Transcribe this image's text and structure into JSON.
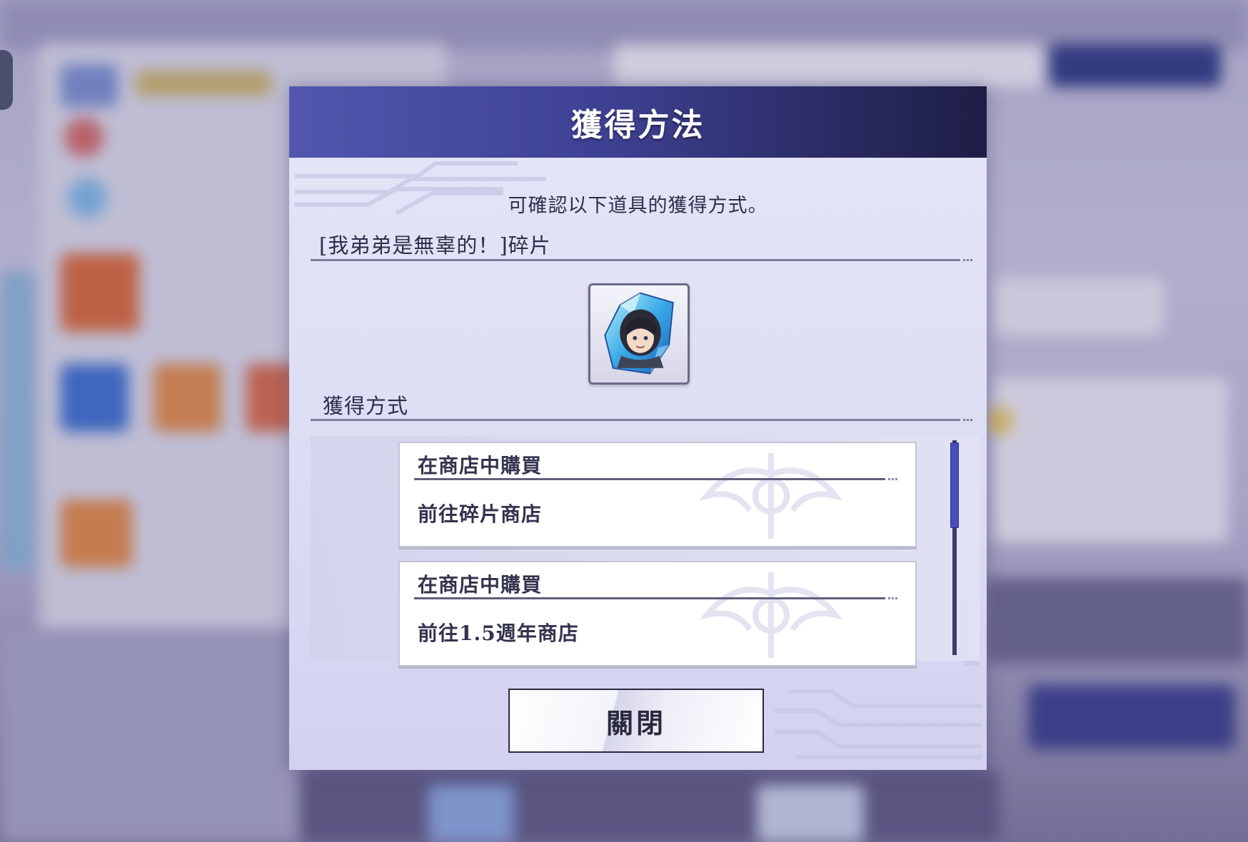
{
  "dialog": {
    "title": "獲得方法",
    "subtitle": "可確認以下道具的獲得方式。",
    "item_name": "[我弟弟是無辜的！]碎片",
    "item_icon": "character-shard-icon",
    "section_label": "獲得方式",
    "sources": [
      {
        "title": "在商店中購買",
        "action": "前往碎片商店"
      },
      {
        "title": "在商店中購買",
        "action": "前往1.5週年商店"
      }
    ],
    "close_label": "關閉"
  },
  "colors": {
    "header_start": "#5257ad",
    "header_end": "#1e1d45",
    "panel_bg": "#dcdcf4",
    "text_dark": "#2e2e4c",
    "scroll_thumb": "#4a4dc0"
  }
}
